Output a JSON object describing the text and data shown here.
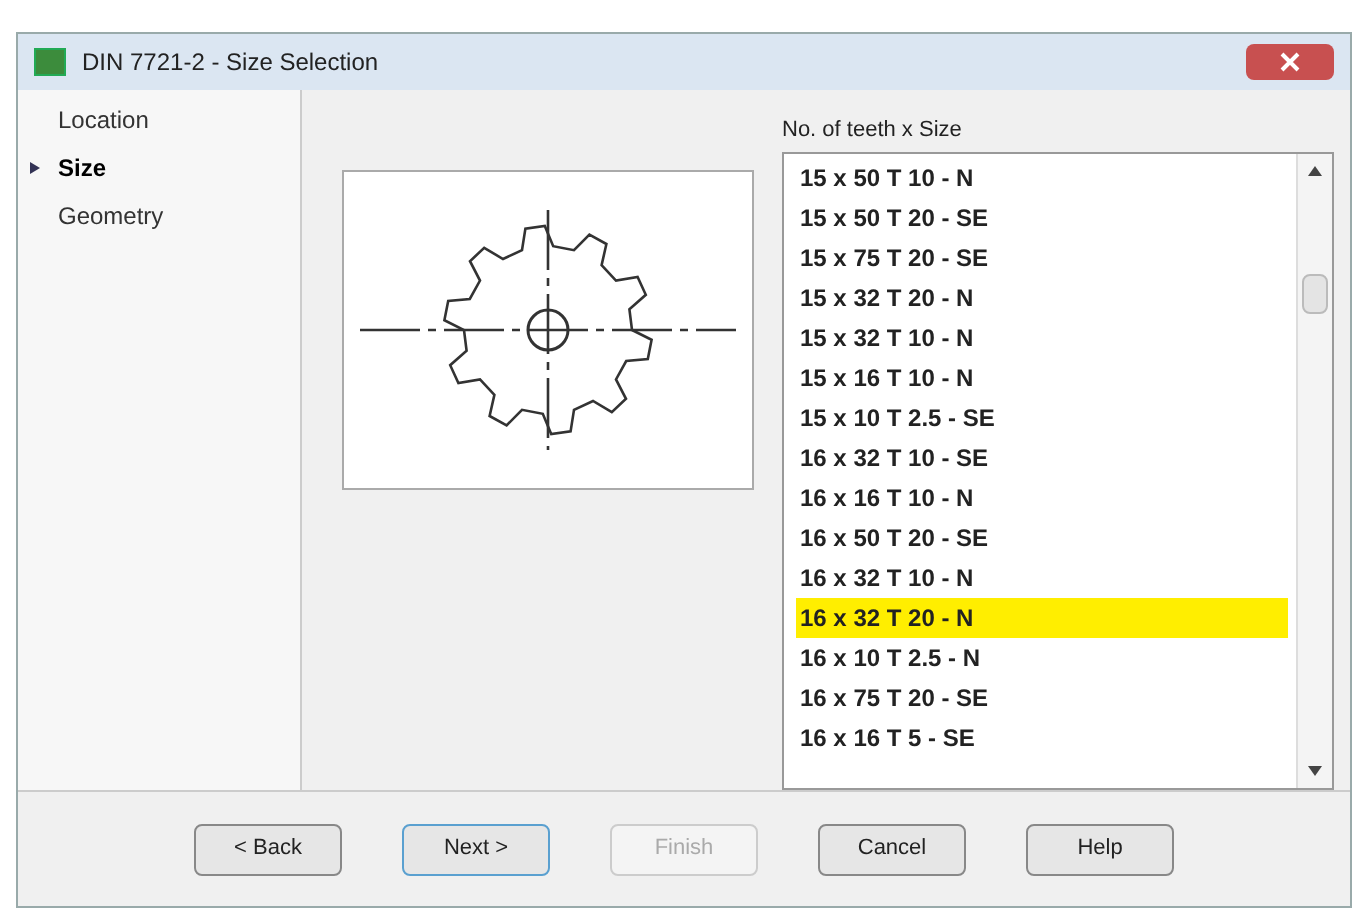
{
  "window": {
    "title": "DIN 7721-2 - Size Selection"
  },
  "steps": [
    {
      "label": "Location",
      "selected": false
    },
    {
      "label": "Size",
      "selected": true
    },
    {
      "label": "Geometry",
      "selected": false
    }
  ],
  "list": {
    "label": "No. of teeth x Size",
    "items": [
      {
        "text": "15 x 50 T 10 - N",
        "selected": false
      },
      {
        "text": "15 x 50 T 20 - SE",
        "selected": false
      },
      {
        "text": "15 x 75 T 20 - SE",
        "selected": false
      },
      {
        "text": "15 x 32 T 20 - N",
        "selected": false
      },
      {
        "text": "15 x 32 T 10 - N",
        "selected": false
      },
      {
        "text": "15 x 16 T 10 - N",
        "selected": false
      },
      {
        "text": "15 x 10 T 2.5 - SE",
        "selected": false
      },
      {
        "text": "16 x 32 T 10 - SE",
        "selected": false
      },
      {
        "text": "16 x 16 T 10 - N",
        "selected": false
      },
      {
        "text": "16 x 50 T 20 - SE",
        "selected": false
      },
      {
        "text": "16 x 32 T 10 - N",
        "selected": false
      },
      {
        "text": "16 x 32 T 20 - N",
        "selected": true
      },
      {
        "text": "16 x 10 T 2.5 - N",
        "selected": false
      },
      {
        "text": "16 x 75 T 20 - SE",
        "selected": false
      },
      {
        "text": "16 x 16 T 5 - SE",
        "selected": false
      }
    ]
  },
  "buttons": [
    {
      "label": "< Back",
      "disabled": false,
      "focused": false
    },
    {
      "label": "Next >",
      "disabled": false,
      "focused": true
    },
    {
      "label": "Finish",
      "disabled": true,
      "focused": false
    },
    {
      "label": "Cancel",
      "disabled": false,
      "focused": false
    },
    {
      "label": "Help",
      "disabled": false,
      "focused": false
    }
  ]
}
